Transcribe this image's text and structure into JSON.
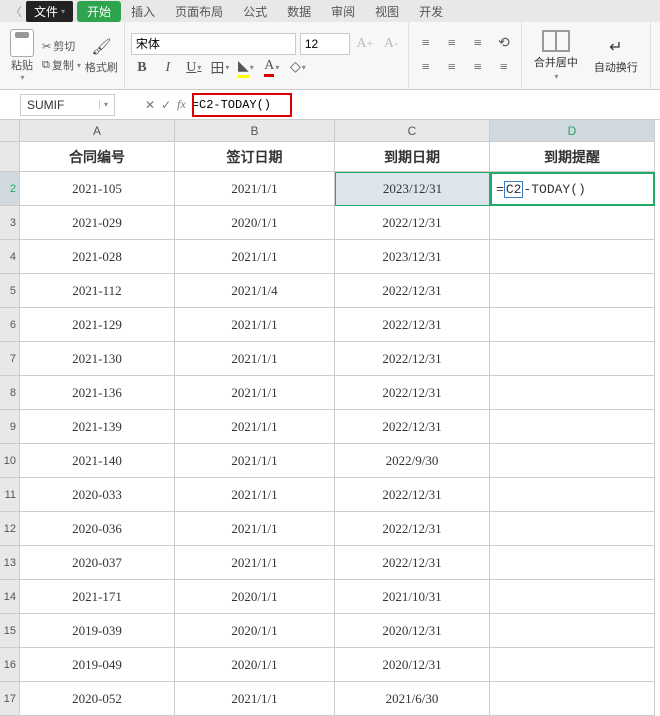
{
  "menubar": {
    "file": "文件",
    "tabs": [
      "开始",
      "插入",
      "页面布局",
      "公式",
      "数据",
      "审阅",
      "视图",
      "开发"
    ],
    "active_index": 0
  },
  "ribbon": {
    "paste": "粘贴",
    "cut": "剪切",
    "copy": "复制",
    "format_painter": "格式刷",
    "font_name": "宋体",
    "font_size": "12",
    "merge_center": "合并居中",
    "auto_wrap": "自动换行"
  },
  "formula_bar": {
    "name_box": "SUMIF",
    "formula": "=C2-TODAY()"
  },
  "grid": {
    "columns": [
      "A",
      "B",
      "C",
      "D"
    ],
    "selected_col_index": 3,
    "header_row": [
      "合同编号",
      "签订日期",
      "到期日期",
      "到期提醒"
    ],
    "editing_cell": {
      "row": 2,
      "col": "D",
      "text_before": "=",
      "ref": "C2",
      "text_after": "-TODAY()"
    },
    "selected_cell": {
      "row": 2,
      "col": "C"
    },
    "rows": [
      {
        "n": 2,
        "A": "2021-105",
        "B": "2021/1/1",
        "C": "2023/12/31"
      },
      {
        "n": 3,
        "A": "2021-029",
        "B": "2020/1/1",
        "C": "2022/12/31"
      },
      {
        "n": 4,
        "A": "2021-028",
        "B": "2021/1/1",
        "C": "2023/12/31"
      },
      {
        "n": 5,
        "A": "2021-112",
        "B": "2021/1/4",
        "C": "2022/12/31"
      },
      {
        "n": 6,
        "A": "2021-129",
        "B": "2021/1/1",
        "C": "2022/12/31"
      },
      {
        "n": 7,
        "A": "2021-130",
        "B": "2021/1/1",
        "C": "2022/12/31"
      },
      {
        "n": 8,
        "A": "2021-136",
        "B": "2021/1/1",
        "C": "2022/12/31"
      },
      {
        "n": 9,
        "A": "2021-139",
        "B": "2021/1/1",
        "C": "2022/12/31"
      },
      {
        "n": 10,
        "A": "2021-140",
        "B": "2021/1/1",
        "C": "2022/9/30"
      },
      {
        "n": 11,
        "A": "2020-033",
        "B": "2021/1/1",
        "C": "2022/12/31"
      },
      {
        "n": 12,
        "A": "2020-036",
        "B": "2021/1/1",
        "C": "2022/12/31"
      },
      {
        "n": 13,
        "A": "2020-037",
        "B": "2021/1/1",
        "C": "2022/12/31"
      },
      {
        "n": 14,
        "A": "2021-171",
        "B": "2020/1/1",
        "C": "2021/10/31"
      },
      {
        "n": 15,
        "A": "2019-039",
        "B": "2020/1/1",
        "C": "2020/12/31"
      },
      {
        "n": 16,
        "A": "2019-049",
        "B": "2020/1/1",
        "C": "2020/12/31"
      },
      {
        "n": 17,
        "A": "2020-052",
        "B": "2021/1/1",
        "C": "2021/6/30"
      }
    ]
  }
}
